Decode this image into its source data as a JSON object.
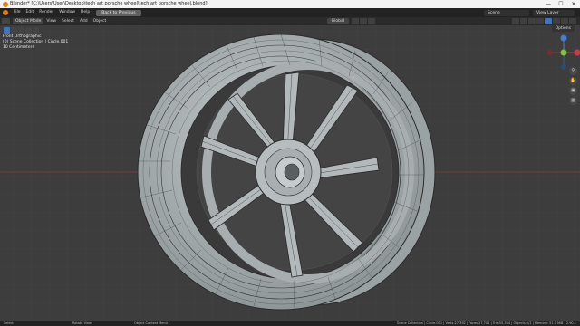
{
  "window": {
    "title": "Blender* [C:\\Users\\User\\Desktop\\tech art porsche wheel\\tech art porsche wheel.blend]",
    "controls": [
      "—",
      "☐",
      "✕"
    ]
  },
  "topbar": {
    "menus": [
      "File",
      "Edit",
      "Render",
      "Window",
      "Help"
    ],
    "workspace_tab": "Back to Previous",
    "scene": "Scene",
    "view_layer": "View Layer"
  },
  "header": {
    "mode": "Object Mode",
    "menus": [
      "View",
      "Select",
      "Add",
      "Object"
    ],
    "pivot": "Global"
  },
  "viewport": {
    "overlay_lines": [
      "Front Orthographic",
      "(0) Scene Collection | Circle.001",
      "10 Centimeters"
    ],
    "options_label": "Options",
    "gizmo": {
      "z_label": "Z",
      "y_label": "Y",
      "x_label": "X"
    }
  },
  "statusbar": {
    "left1": "Select",
    "left2": "Rotate View",
    "left3": "Object Context Menu",
    "stats": "Scene Collection | Circle.001 | Verts:27,392 | Faces:27,702 | Tris:55,364 | Objects:0/1 | Memory: 51.1 MiB | 2.90.1"
  },
  "colors": {
    "accent": "#4772b3",
    "blender_orange": "#e87d0d",
    "viewport_bg": "#3d3d3d",
    "grid": "#474747",
    "axis_red": "#b1414d",
    "mesh_fill": "#b2b8b9",
    "mesh_wire": "#2a2a2a"
  }
}
